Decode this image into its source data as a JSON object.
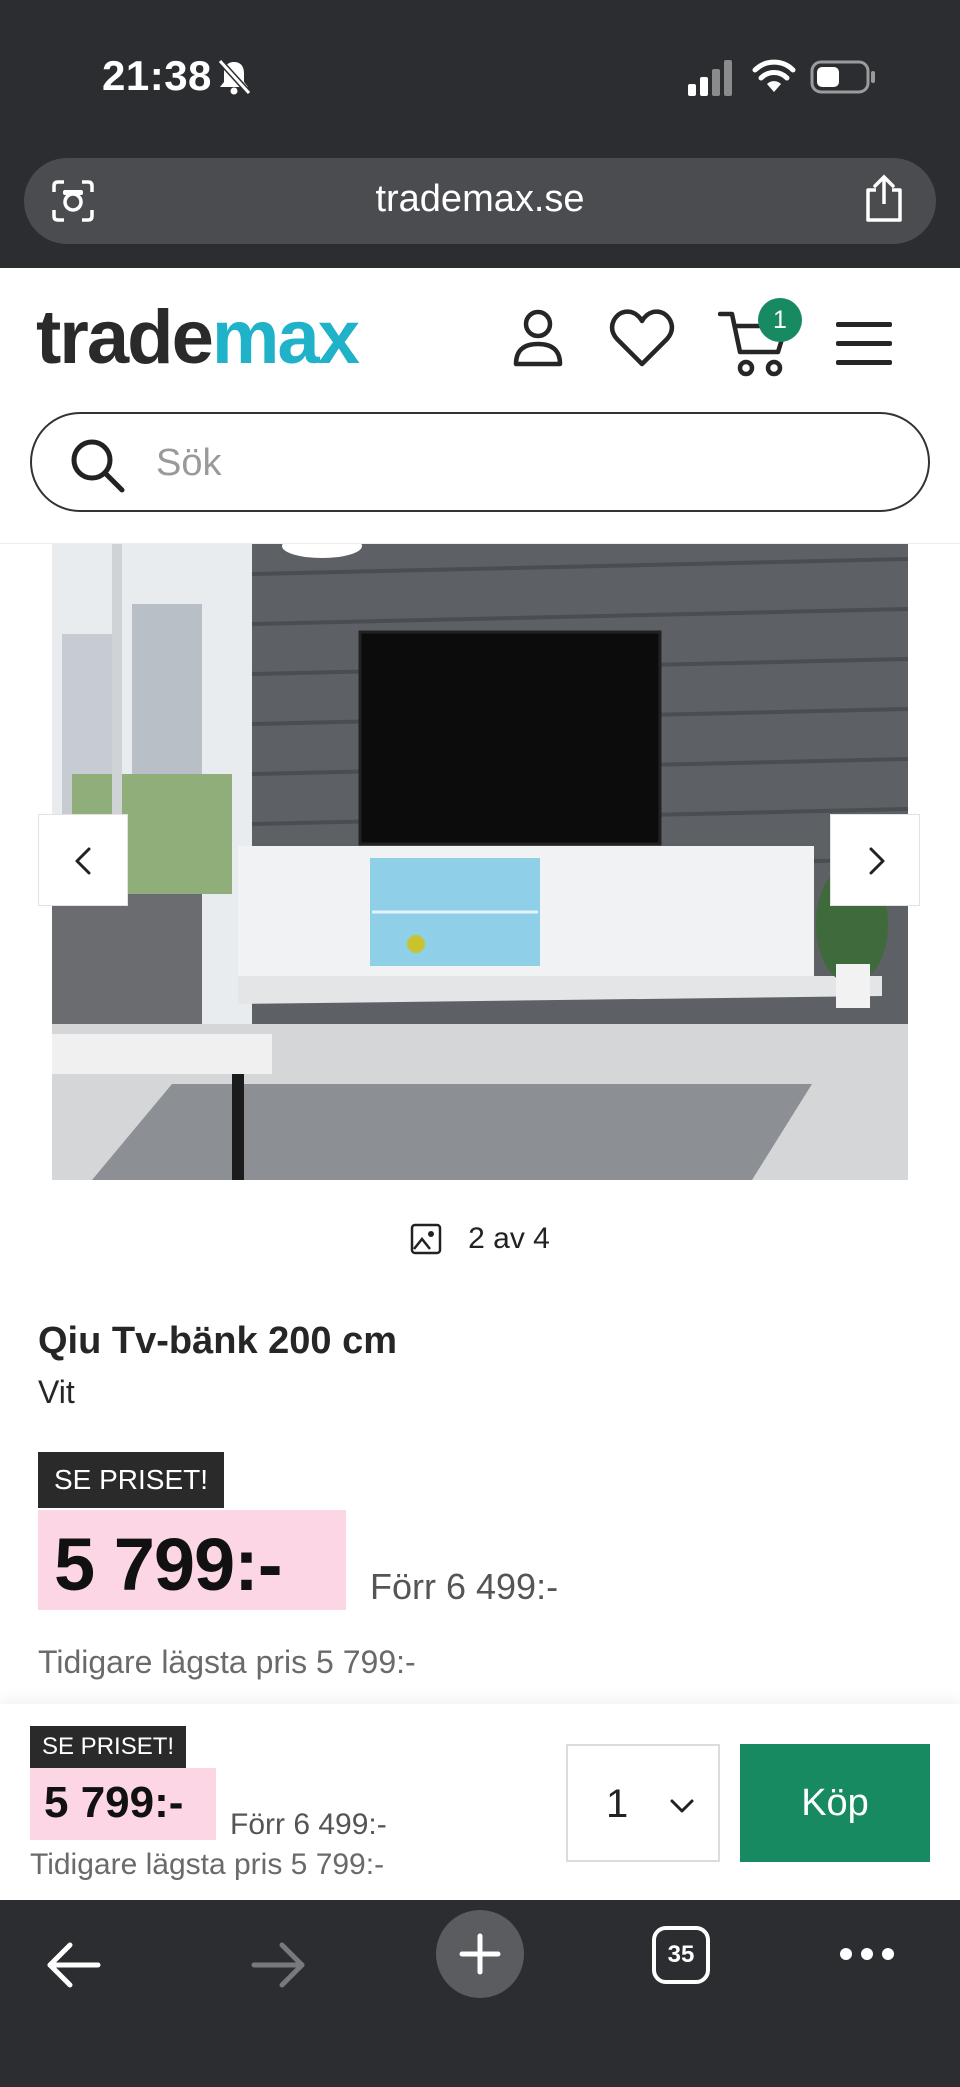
{
  "status_bar": {
    "time": "21:38",
    "icons": [
      "bell-slash-icon",
      "signal-icon",
      "wifi-icon",
      "battery-icon"
    ]
  },
  "browser": {
    "url": "trademax.se",
    "toolbar": {
      "tabs_count": "35",
      "icons": [
        "back-arrow-icon",
        "forward-arrow-icon",
        "plus-icon",
        "tabs-icon",
        "more-icon"
      ]
    }
  },
  "header": {
    "logo_part1": "trade",
    "logo_part2": "max",
    "cart_count": "1",
    "search_placeholder": "Sök",
    "icons": [
      "user-icon",
      "heart-icon",
      "cart-icon",
      "menu-icon",
      "search-icon"
    ]
  },
  "gallery": {
    "counter": "2 av 4"
  },
  "product": {
    "title": "Qiu Tv-bänk 200 cm",
    "variant": "Vit",
    "promo_tag": "SE PRISET!",
    "price": "5 799:-",
    "was_price": "Förr 6 499:-",
    "lowest_price": "Tidigare lägsta pris 5 799:-"
  },
  "buybar": {
    "promo_tag": "SE PRISET!",
    "price": "5 799:-",
    "was_price": "Förr 6 499:-",
    "lowest_price": "Tidigare lägsta pris 5 799:-",
    "quantity": "1",
    "buy_label": "Köp"
  },
  "colors": {
    "brand_green": "#178a61",
    "logo_accent": "#1fb2c9",
    "price_bg": "#fcd6e4",
    "chrome_dark": "#2b2d30"
  }
}
